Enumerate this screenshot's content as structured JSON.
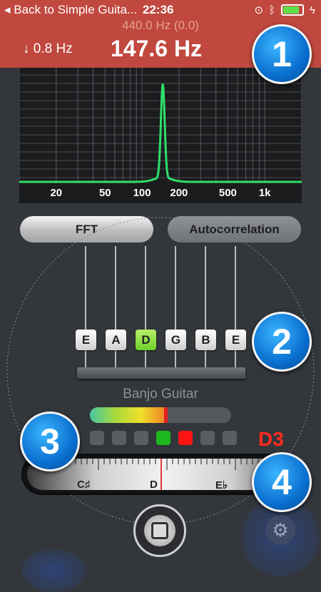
{
  "status_bar": {
    "back_label": "Back to Simple Guita...",
    "time": "22:36"
  },
  "header": {
    "reference_hz": "440.0 Hz (0.0)",
    "offset_hz": "0.8 Hz",
    "main_frequency": "147.6 Hz"
  },
  "spectrum": {
    "x_labels": [
      "20",
      "50",
      "100",
      "200",
      "500",
      "1k"
    ],
    "peak_hz": 147.6
  },
  "mode_buttons": {
    "fft": "FFT",
    "autocorrelation": "Autocorrelation",
    "selected": "FFT"
  },
  "tuner": {
    "strings": [
      "E",
      "A",
      "D",
      "G",
      "B",
      "E"
    ],
    "active_string_index": 2,
    "instrument": "Banjo Guitar",
    "level_fraction": 0.54,
    "indicator_dots": [
      "off",
      "off",
      "off",
      "green",
      "red",
      "off",
      "off"
    ],
    "detected_note": "D3",
    "ruler_labels": [
      "C♯",
      "D",
      "E♭"
    ]
  },
  "badges": [
    "1",
    "2",
    "3",
    "4"
  ],
  "colors": {
    "header_bg": "#c0483f",
    "spectrum_line": "#2ee06a",
    "active_string": "#86dd3b",
    "note_red": "#ff2b1f",
    "badge_blue": "#0a6fd0"
  },
  "icons": [
    "chevron-left-icon",
    "lock-rotation-icon",
    "bluetooth-icon",
    "battery-icon",
    "charging-icon",
    "arrow-down-icon",
    "home-button-icon",
    "gear-icon"
  ]
}
